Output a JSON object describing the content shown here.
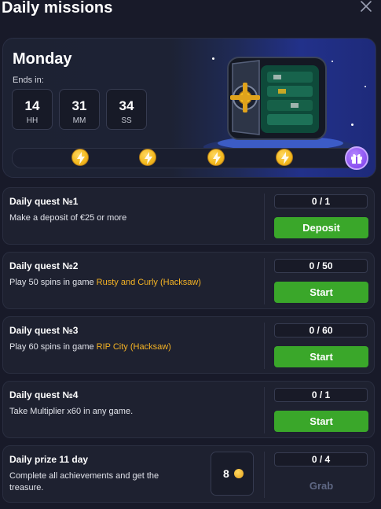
{
  "header": {
    "title": "Daily missions"
  },
  "hero": {
    "day": "Monday",
    "ends_label": "Ends in:",
    "timer": [
      {
        "value": "14",
        "unit": "HH"
      },
      {
        "value": "31",
        "unit": "MM"
      },
      {
        "value": "34",
        "unit": "SS"
      }
    ],
    "milestones": 4,
    "icons": {
      "milestone": "lightning-icon",
      "reward": "gift-icon",
      "art": "safe-vault"
    },
    "colors": {
      "milestone": "#f3b81c",
      "reward": "#8a4ff0"
    }
  },
  "quests": [
    {
      "title": "Daily quest №1",
      "desc_pre": "Make a deposit of €25 or more",
      "game": "",
      "progress": "0 / 1",
      "button": "Deposit"
    },
    {
      "title": "Daily quest №2",
      "desc_pre": "Play 50 spins in game ",
      "game": "Rusty and Curly (Hacksaw)",
      "progress": "0 / 50",
      "button": "Start"
    },
    {
      "title": "Daily quest №3",
      "desc_pre": "Play 60 spins in game ",
      "game": "RIP City (Hacksaw)",
      "progress": "0 / 60",
      "button": "Start"
    },
    {
      "title": "Daily quest №4",
      "desc_pre": "Take Multiplier x60 in any game.",
      "game": "",
      "progress": "0 / 1",
      "button": "Start"
    }
  ],
  "prize": {
    "title": "Daily prize 11 day",
    "desc": "Complete all achievements and get the treasure.",
    "value": "8",
    "progress": "0 / 4",
    "button": "Grab"
  },
  "colors": {
    "accent": "#3aa72a",
    "game_link": "#f5b324",
    "background": "#181a29"
  }
}
